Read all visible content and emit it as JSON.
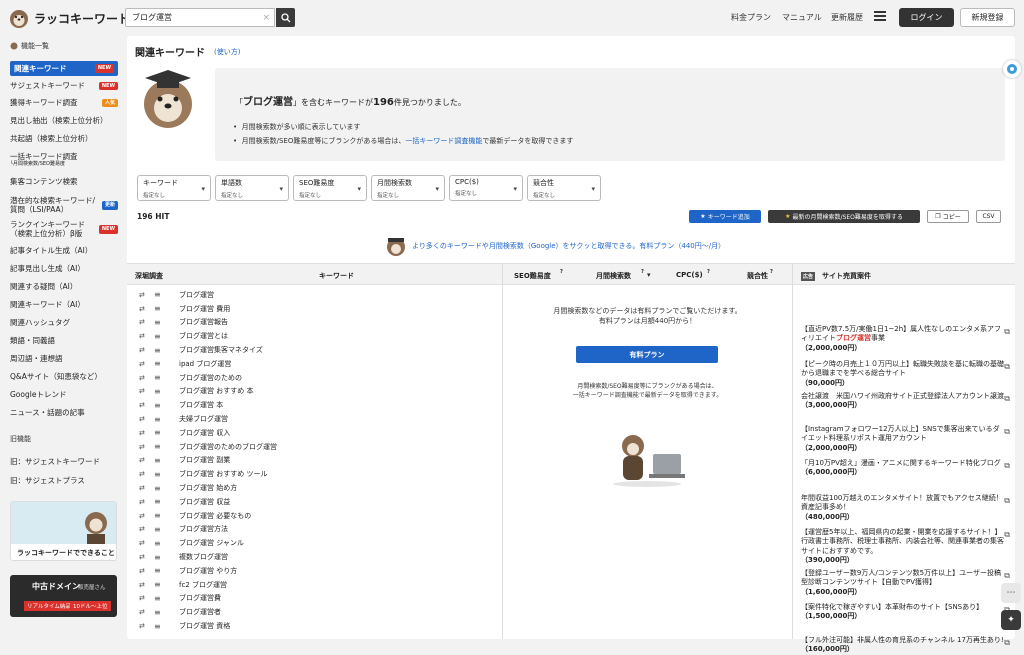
{
  "header": {
    "logo_text": "ラッコキーワード",
    "search_value": "ブログ運営",
    "clear_icon": "×",
    "nav": [
      "料金プラン",
      "マニュアル",
      "更新履歴"
    ],
    "login": "ログイン",
    "signup": "新規登録"
  },
  "sidebar": {
    "section_functions": "機能一覧",
    "items": [
      {
        "label": "関連キーワード",
        "badge": "NEW"
      },
      {
        "label": "サジェストキーワード",
        "badge": "NEW"
      },
      {
        "label": "獲得キーワード調査",
        "badge": "人気"
      },
      {
        "label": "見出し抽出（検索上位分析）",
        "badge": ""
      },
      {
        "label": "共起語（検索上位分析）",
        "badge": ""
      },
      {
        "label": "一括キーワード調査",
        "sub": "└月間検索数/SEO難易度",
        "badge": ""
      },
      {
        "label": "集客コンテンツ検索",
        "badge": ""
      },
      {
        "label": "潜在的な検索キーワード/",
        "sub": "質問（LSI/PAA）",
        "badge": "更新"
      },
      {
        "label": "ランクインキーワード",
        "sub": "（検索上位分析）β版",
        "badge": "NEW"
      },
      {
        "label": "記事タイトル生成（AI）",
        "badge": ""
      },
      {
        "label": "記事見出し生成（AI）",
        "badge": ""
      },
      {
        "label": "関連する疑問（AI）",
        "badge": ""
      },
      {
        "label": "関連キーワード（AI）",
        "badge": ""
      },
      {
        "label": "関連ハッシュタグ",
        "badge": ""
      },
      {
        "label": "類語・同義語",
        "badge": ""
      },
      {
        "label": "周辺語・連想語",
        "badge": ""
      },
      {
        "label": "Q&Aサイト（知恵袋など）",
        "badge": ""
      },
      {
        "label": "Googleトレンド",
        "badge": ""
      },
      {
        "label": "ニュース・話題の記事",
        "badge": ""
      }
    ],
    "section_old": "旧機能",
    "old_items": [
      "旧：サジェストキーワード",
      "旧：サジェストプラス"
    ],
    "banner1_text": "ラッコキーワードでできること",
    "banner2_title": "中古ドメイン",
    "banner2_sub": "販売屋さん",
    "banner2_tag1": "リアルタイム納品",
    "banner2_tag2": "10ドル〜上位"
  },
  "main": {
    "title": "関連キーワード",
    "usage_link": "(使い方)",
    "result_prefix": "「",
    "result_keyword": "ブログ運営",
    "result_mid": "」を含むキーワードが",
    "result_count": "196",
    "result_suffix": "件見つかりました。",
    "bullet1": "月間検索数が多い順に表示しています",
    "bullet2_pre": "月間検索数/SEO難易度等にブランクがある場合は、",
    "bullet2_link": "一括キーワード調査機能",
    "bullet2_post": "で最新データを取得できます",
    "filters": [
      {
        "label": "キーワード",
        "sub": "指定なし"
      },
      {
        "label": "単語数",
        "sub": "指定なし"
      },
      {
        "label": "SEO難易度",
        "sub": "指定なし"
      },
      {
        "label": "月間検索数",
        "sub": "指定なし"
      },
      {
        "label": "CPC($)",
        "sub": "指定なし"
      },
      {
        "label": "競合性",
        "sub": "指定なし"
      }
    ],
    "hits": "196 HIT",
    "btn_add_keyword": "キーワード追加",
    "btn_fetch_latest": "最新の月間検索数/SEO難易度を取得する",
    "btn_copy": "コピー",
    "btn_csv": "CSV",
    "promo_text": "より多くのキーワードや月間検索数（Google）をサクッと取得できる。有料プラン（440円〜/月）"
  },
  "table": {
    "headers": [
      "深堀調査",
      "キーワード",
      "SEO難易度",
      "月間検索数",
      "CPC($)",
      "競合性"
    ],
    "sites_header": "サイト売買案件",
    "sites_badge": "広告",
    "keywords": [
      "ブログ運営",
      "ブログ運営 費用",
      "ブログ運営報告",
      "ブログ運営とは",
      "ブログ運営集客マネタイズ",
      "ipad ブログ運営",
      "ブログ運営のための",
      "ブログ運営 おすすめ 本",
      "ブログ運営 本",
      "夫婦ブログ運営",
      "ブログ運営 収入",
      "ブログ運営のためのブログ運営",
      "ブログ運営 副業",
      "ブログ運営 おすすめ ツール",
      "ブログ運営 始め方",
      "ブログ運営 収益",
      "ブログ運営 必要なもの",
      "ブログ運営方法",
      "ブログ運営 ジャンル",
      "複数ブログ運営",
      "ブログ運営 やり方",
      "fc2 ブログ運営",
      "ブログ運営費",
      "ブログ運営者",
      "ブログ運営 資格"
    ]
  },
  "paywall": {
    "line1": "月間検索数などのデータは有料プランでご覧いただけます。",
    "line2": "有料プランは月額440円から！",
    "button": "有料プラン",
    "note1": "月間検索数/SEO難易度等にブランクがある場合は、",
    "note2": "一括キーワード調査機能で最新データを取得できます。"
  },
  "sites": [
    {
      "pre": "【直近PV数7.5万/実働1日1~2h】属人性なしのエンタメ系アフィリエイト",
      "hl": "ブログ運営",
      "post": "事業",
      "price": "（2,000,000円）"
    },
    {
      "pre": "【ピーク時の月売上１０万円以上】転職失敗談を基に転職の基礎から退職までを学べる総合サイト",
      "hl": "",
      "post": "",
      "price": "（90,000円）"
    },
    {
      "pre": "会社譲渡　米国ハワイ州政府サイト正式登録法人アカウント譲渡",
      "hl": "",
      "post": "",
      "price": "（3,000,000円）"
    },
    {
      "pre": "【Instagramフォロワー12万人以上】SNSで集客出来ているダイエット料理系リポスト運用アカウント",
      "hl": "",
      "post": "",
      "price": "（2,000,000円）"
    },
    {
      "pre": "「月10万PV超え」漫画・アニメに関するキーワード特化ブログ",
      "hl": "",
      "post": "",
      "price": "（6,000,000円）"
    },
    {
      "pre": "年間収益100万越えのエンタメサイト！放置でもアクセス継続！資産記事多め！",
      "hl": "",
      "post": "",
      "price": "（480,000円）"
    },
    {
      "pre": "【運営歴5年以上、福岡県内の起業・開業を応援するサイト！】行政書士事務所、税理士事務所、内装会社等、関連事業者の集客サイトにおすすめです。",
      "hl": "",
      "post": "",
      "price": "（390,000円）"
    },
    {
      "pre": "【登録ユーザー数9万人/コンテンツ数5万件以上】ユーザー投稿型診断コンテンツサイト【自動でPV獲得】",
      "hl": "",
      "post": "",
      "price": "（1,600,000円）"
    },
    {
      "pre": "【案件特化で稼ぎやすい】本革財布のサイト【SNSあり】",
      "hl": "",
      "post": "",
      "price": "（1,500,000円）"
    },
    {
      "pre": "【フル外注可能】非属人性の育児系のチャンネル 17万再生あり!",
      "hl": "",
      "post": "",
      "price": "（160,000円）"
    }
  ]
}
